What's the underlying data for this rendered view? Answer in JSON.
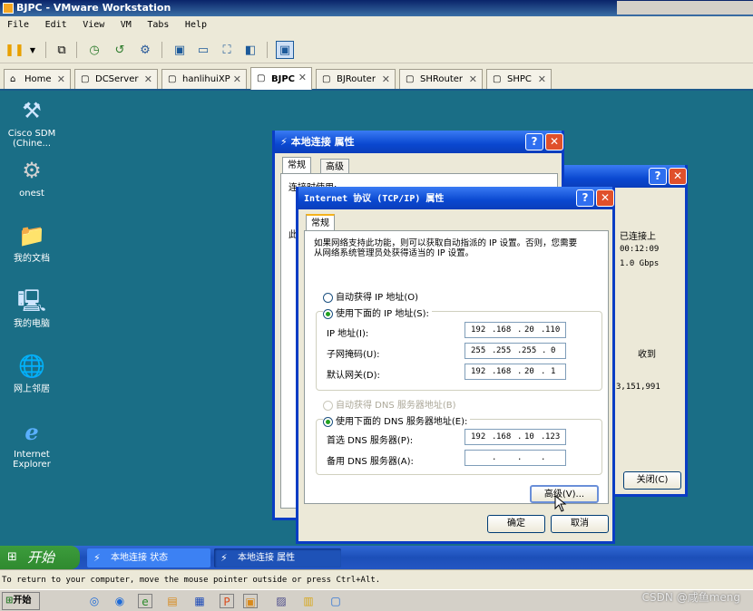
{
  "vmware": {
    "title": "BJPC - VMware Workstation",
    "menu": [
      "File",
      "Edit",
      "View",
      "VM",
      "Tabs",
      "Help"
    ],
    "tabs": [
      {
        "label": "Home",
        "icon": "home-icon"
      },
      {
        "label": "DCServer",
        "icon": "vm-icon"
      },
      {
        "label": "hanlihuiXP",
        "icon": "vm-icon"
      },
      {
        "label": "BJPC",
        "icon": "vm-icon",
        "active": true
      },
      {
        "label": "BJRouter",
        "icon": "vm-icon"
      },
      {
        "label": "SHRouter",
        "icon": "vm-icon"
      },
      {
        "label": "SHPC",
        "icon": "vm-icon"
      }
    ],
    "status_text": "To return to your computer, move the mouse pointer outside or press Ctrl+Alt."
  },
  "desktop": {
    "icons": [
      {
        "label": "Cisco SDM\n(Chine...",
        "icon": "cisco-sdm-icon"
      },
      {
        "label": "onest",
        "icon": "app-icon"
      },
      {
        "label": "我的文档",
        "icon": "my-documents-icon"
      },
      {
        "label": "我的电脑",
        "icon": "my-computer-icon"
      },
      {
        "label": "网上邻居",
        "icon": "network-places-icon"
      },
      {
        "label": "Internet\nExplorer",
        "icon": "internet-explorer-icon"
      }
    ]
  },
  "properties_window": {
    "title": "本地连接 属性",
    "tabs": [
      "常规",
      "高级"
    ],
    "connect_using_label": "连接时使用:",
    "partial_char": "此"
  },
  "status_window": {
    "status_value": "已连接上",
    "duration_value": "00:12:09",
    "speed_value": "1.0 Gbps",
    "received_label": "收到",
    "received_value": "3,151,991",
    "close_button": "关闭(C)"
  },
  "tcpip_dialog": {
    "title": "Internet 协议 (TCP/IP) 属性",
    "tab": "常规",
    "intro": "如果网络支持此功能，则可以获取自动指派的 IP 设置。否则，您需要从网络系统管理员处获得适当的 IP 设置。",
    "auto_ip_label": "自动获得 IP 地址(O)",
    "manual_ip_label": "使用下面的 IP 地址(S):",
    "ip_label": "IP 地址(I):",
    "ip_octets": [
      "192",
      "168",
      "20",
      "110"
    ],
    "mask_label": "子网掩码(U):",
    "mask_octets": [
      "255",
      "255",
      "255",
      "0"
    ],
    "gateway_label": "默认网关(D):",
    "gateway_octets": [
      "192",
      "168",
      "20",
      "1"
    ],
    "auto_dns_label": "自动获得 DNS 服务器地址(B)",
    "manual_dns_label": "使用下面的 DNS 服务器地址(E):",
    "pref_dns_label": "首选 DNS 服务器(P):",
    "pref_dns_octets": [
      "192",
      "168",
      "10",
      "123"
    ],
    "alt_dns_label": "备用 DNS 服务器(A):",
    "advanced_button": "高级(V)...",
    "ok_button": "确定",
    "cancel_button": "取消"
  },
  "guest_taskbar": {
    "start_label": "开始",
    "items": [
      "本地连接 状态",
      "本地连接 属性"
    ]
  },
  "host_taskbar": {
    "start_label": "开始"
  },
  "watermark": "CSDN @咸鱼meng"
}
